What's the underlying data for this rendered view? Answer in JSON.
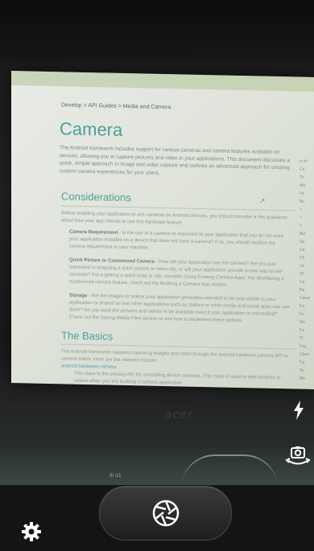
{
  "viewfinder": {
    "breadcrumb": "Develop > API Guides > Media and Camera",
    "title": "Camera",
    "intro": "The Android framework includes support for various cameras and camera features available on devices, allowing you to capture pictures and video in your applications. This document discusses a quick, simple approach to image and video capture and outlines an advanced approach for creating custom camera experiences for your users.",
    "considerations_heading": "Considerations",
    "considerations_intro": "Before enabling your application to use cameras on Android devices, you should consider a few questions about how your app intends to use this hardware feature.",
    "bullets": [
      {
        "label": "Camera Requirement",
        "text": " - Is the use of a camera so important to your application that you do not want your application installed on a device that does not have a camera? If so, you should declare the camera requirement in your manifest."
      },
      {
        "label": "Quick Picture or Customized Camera",
        "text": " - How will your application use the camera? Are you just interested in snapping a quick picture or video clip, or will your application provide a new way to use cameras? For a getting a quick snap or clip, consider Using Existing Camera Apps. For developing a customized camera feature, check out the Building a Camera App section."
      },
      {
        "label": "Storage",
        "text": " - Are the images or videos your application generates intended to be only visible to your application or shared so that other applications such as Gallery or other media and social apps can use them? Do you want the pictures and videos to be available even if your application is uninstalled? Check out the Saving Media Files section to see how to implement these options."
      }
    ],
    "basics_heading": "The Basics",
    "basics_intro": "The Android framework supports capturing images and video through the android.hardware.camera API or camera Intent. Here are the relevant classes:",
    "basics_sub": "android.hardware.camera",
    "basics_note": "This class is the primary API for controlling device cameras. This class is used to take pictures or videos when you are building a camera application.",
    "sidebar_items": [
      "In th",
      "Co",
      "Th",
      "Ma",
      "Us",
      "Bu",
      ">",
      ">",
      ">",
      "",
      "Bui",
      "Sa",
      "Ca",
      "Ch",
      "Us",
      "Sh",
      "Ca",
      "Re",
      "Came",
      "Co",
      "Fo",
      "Me",
      "Fa",
      "Ti",
      "Key Class",
      "Ca",
      "Su",
      "Me"
    ],
    "brand": "acer",
    "taskbar": "iti o1"
  },
  "controls": {
    "flash_icon": "flash-icon",
    "switch_icon": "switch-camera-icon",
    "shutter_icon": "shutter-icon",
    "settings_icon": "gear-icon"
  }
}
